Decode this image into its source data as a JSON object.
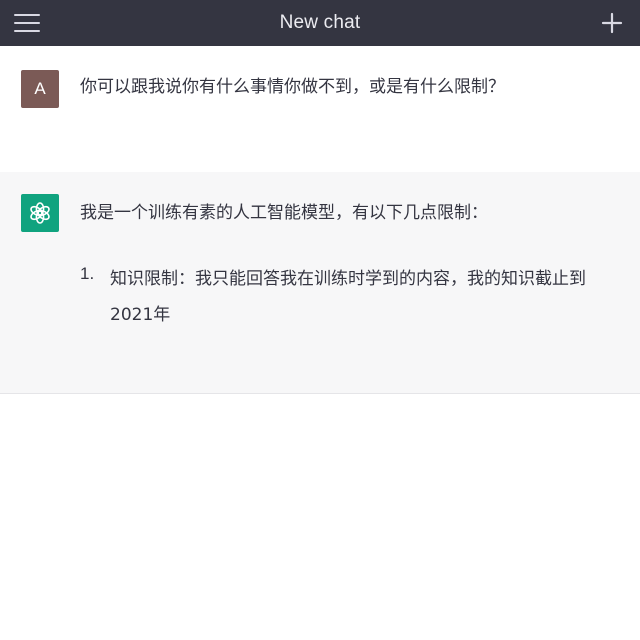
{
  "header": {
    "title": "New chat",
    "menu_icon": "hamburger-menu-icon",
    "new_icon": "plus-icon"
  },
  "conversation": {
    "user_message": {
      "avatar_letter": "A",
      "text": "你可以跟我说你有什么事情你做不到，或是有什么限制？"
    },
    "assistant_message": {
      "avatar_icon": "openai-logo-icon",
      "intro": "我是一个训练有素的人工智能模型，有以下几点限制：",
      "list": [
        {
          "number": "1.",
          "text": "知识限制：我只能回答我在训练时学到的内容，我的知识截止到2021年"
        }
      ]
    }
  },
  "colors": {
    "topbar": "#343541",
    "user_avatar": "#7b5a56",
    "assistant_avatar": "#10a37f",
    "assistant_bg": "#f7f7f8"
  }
}
